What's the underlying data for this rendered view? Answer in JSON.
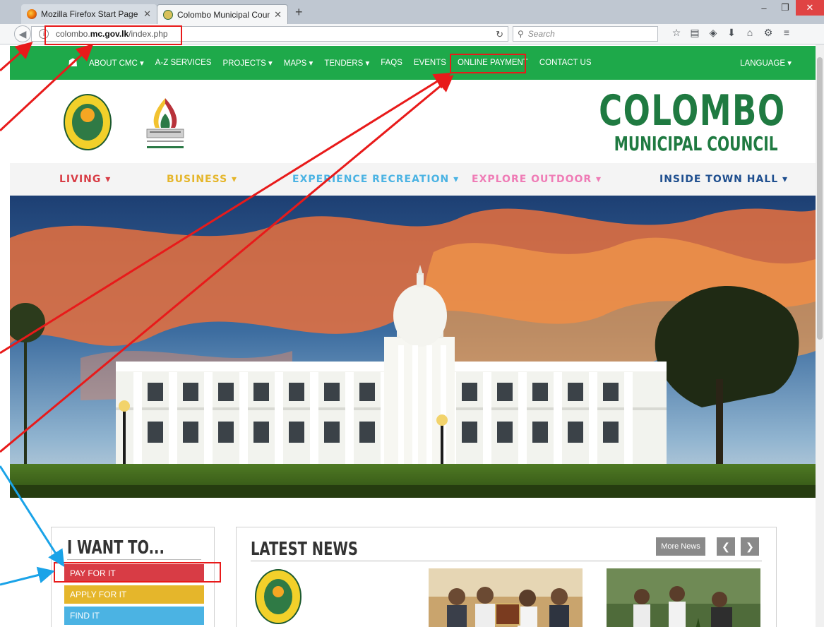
{
  "browser": {
    "tabs": [
      {
        "label": "Mozilla Firefox Start Page",
        "active": false
      },
      {
        "label": "Colombo Municipal Coun...",
        "active": true
      }
    ],
    "url_prefix": "colombo.",
    "url_domain": "mc.gov.lk",
    "url_path": "/index.php",
    "search_placeholder": "Search",
    "window_controls": {
      "minimize": "–",
      "maximize": "❐",
      "close": "✕"
    },
    "toolbar_icons": [
      "bookmark-star-icon",
      "reading-list-icon",
      "pocket-icon",
      "download-icon",
      "home-icon",
      "extension-icon",
      "menu-icon"
    ]
  },
  "topnav": {
    "items": [
      {
        "label": "ABOUT CMC",
        "caret": true
      },
      {
        "label": "A-Z SERVICES",
        "caret": false
      },
      {
        "label": "PROJECTS",
        "caret": true
      },
      {
        "label": "MAPS",
        "caret": true
      },
      {
        "label": "TENDERS",
        "caret": true
      },
      {
        "label": "FAQS",
        "caret": false
      },
      {
        "label": "EVENTS",
        "caret": false
      },
      {
        "label": "ONLINE PAYMENT",
        "caret": false
      },
      {
        "label": "CONTACT US",
        "caret": false
      }
    ],
    "language": "LANGUAGE ▾"
  },
  "brand": {
    "line1": "COLOMBO",
    "line2": "MUNICIPAL COUNCIL"
  },
  "categories": [
    {
      "label": "LIVING ▾",
      "color": "#d83c45"
    },
    {
      "label": "BUSINESS ▾",
      "color": "#e5b62b"
    },
    {
      "label": "EXPERIENCE RECREATION ▾",
      "color": "#4bb3e3"
    },
    {
      "label": "EXPLORE OUTDOOR ▾",
      "color": "#ef7cb6"
    },
    {
      "label": "INSIDE TOWN HALL ▾",
      "color": "#1f4f8f"
    }
  ],
  "want": {
    "title": "I WANT TO...",
    "options": [
      {
        "label": "PAY FOR IT",
        "color": "#d83c45"
      },
      {
        "label": "APPLY FOR IT",
        "color": "#e5b62b"
      },
      {
        "label": "FIND IT",
        "color": "#4bb3e3"
      },
      {
        "label": "",
        "color": "#ef7cb6"
      }
    ]
  },
  "news": {
    "title": "LATEST NEWS",
    "more": "More News",
    "prev": "❮",
    "next": "❯"
  },
  "colors": {
    "topnav_green": "#1ea94a",
    "brand_green": "#1f7a41",
    "annotation_red": "#e81a1a",
    "annotation_blue": "#1aa3e8"
  }
}
